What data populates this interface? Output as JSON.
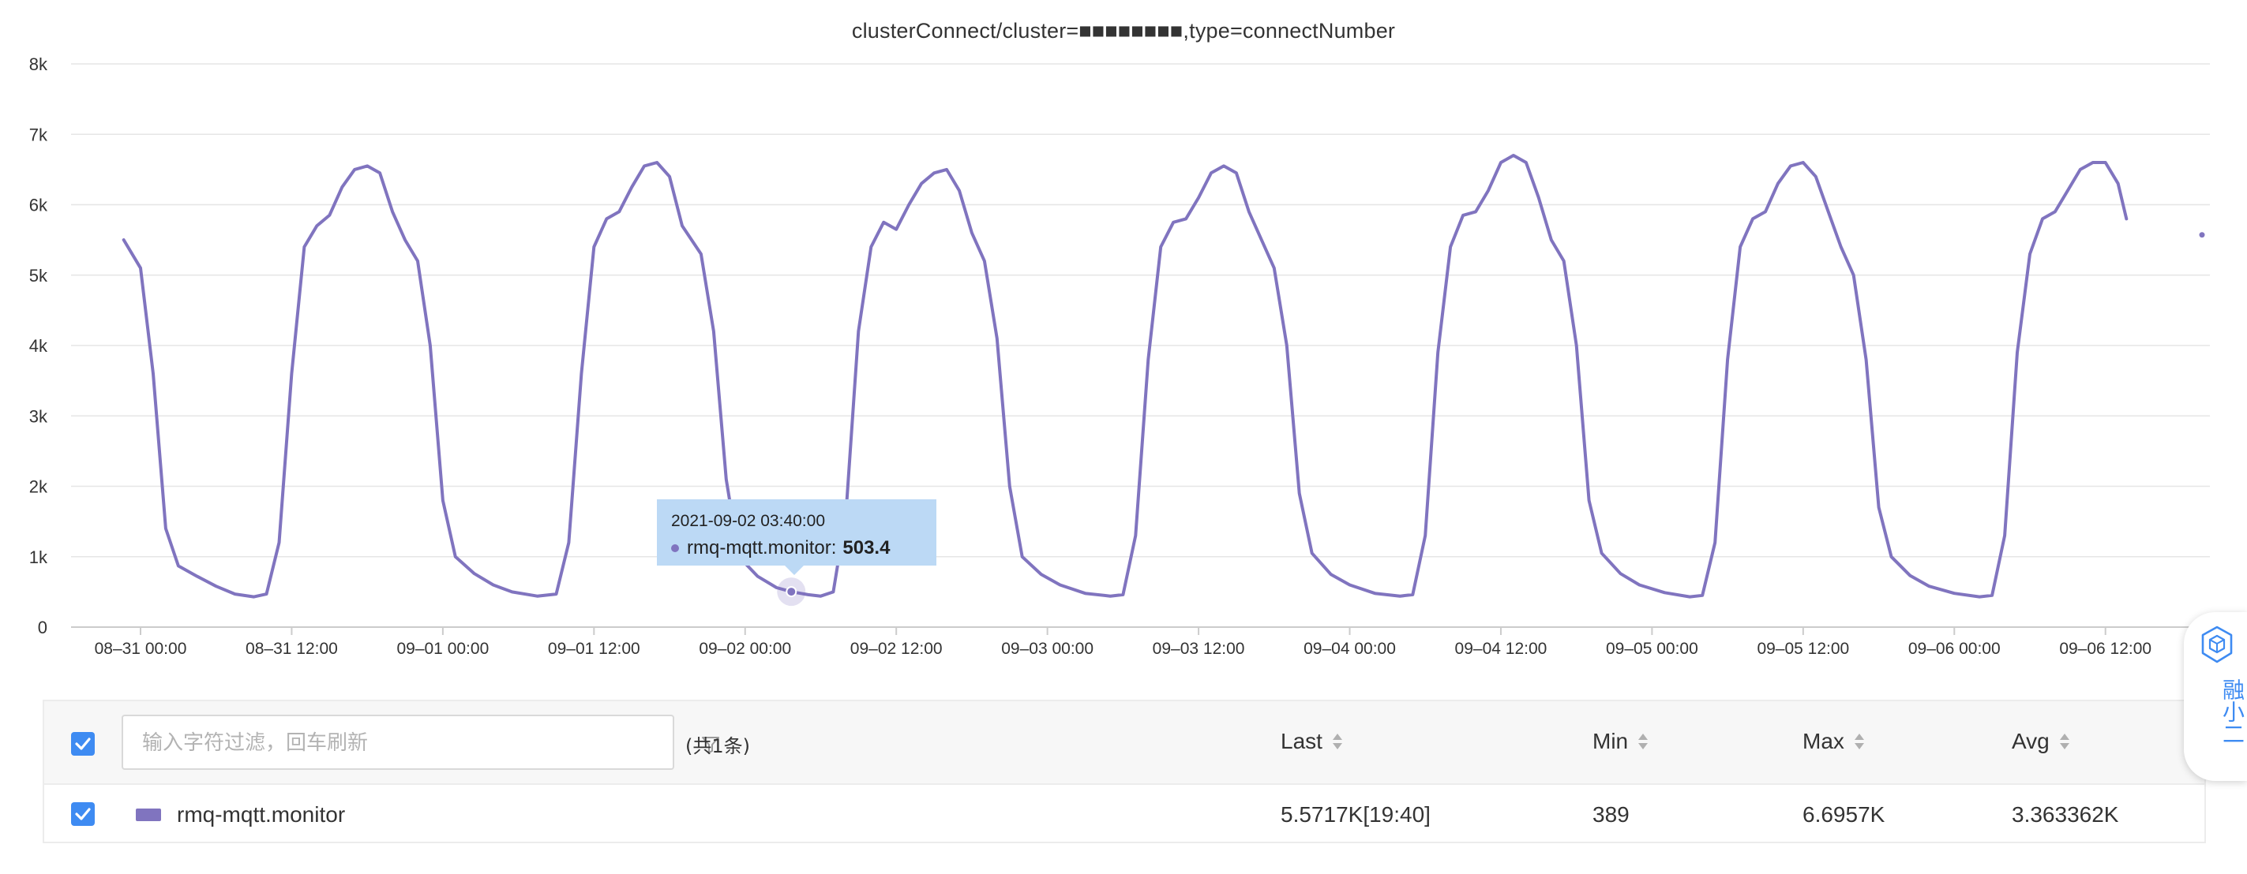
{
  "chart": {
    "title": "clusterConnect/cluster=■■■■■■■■,type=connectNumber",
    "accent_color": "#8074bf",
    "tooltip": {
      "time": "2021-09-02 03:40:00",
      "series": "rmq-mqtt.monitor",
      "value": "503.4"
    }
  },
  "chart_data": {
    "type": "line",
    "title": "clusterConnect/cluster=■■■■■■■■,type=connectNumber",
    "xlabel": "",
    "ylabel": "",
    "y_ticks": [
      "0",
      "1k",
      "2k",
      "3k",
      "4k",
      "5k",
      "6k",
      "7k",
      "8k"
    ],
    "x_ticks": [
      "08-31 00:00",
      "08-31 12:00",
      "09-01 00:00",
      "09-01 12:00",
      "09-02 00:00",
      "09-02 12:00",
      "09-03 00:00",
      "09-03 12:00",
      "09-04 00:00",
      "09-04 12:00",
      "09-05 00:00",
      "09-05 12:00",
      "09-06 00:00",
      "09-06 12:00"
    ],
    "ylim": [
      0,
      8000
    ],
    "xlim": [
      "2021-08-30 22:40",
      "2021-09-06 19:40"
    ],
    "grid": true,
    "series": [
      {
        "name": "rmq-mqtt.monitor",
        "color": "#8074bf",
        "points": [
          [
            "2021-08-30 22:40",
            5500
          ],
          [
            "2021-08-31 00:00",
            5100
          ],
          [
            "2021-08-31 01:00",
            3600
          ],
          [
            "2021-08-31 02:00",
            1400
          ],
          [
            "2021-08-31 03:00",
            870
          ],
          [
            "2021-08-31 04:30",
            720
          ],
          [
            "2021-08-31 06:00",
            580
          ],
          [
            "2021-08-31 07:30",
            470
          ],
          [
            "2021-08-31 09:00",
            430
          ],
          [
            "2021-08-31 10:00",
            470
          ],
          [
            "2021-08-31 11:00",
            1200
          ],
          [
            "2021-08-31 12:00",
            3600
          ],
          [
            "2021-08-31 13:00",
            5400
          ],
          [
            "2021-08-31 14:00",
            5700
          ],
          [
            "2021-08-31 15:00",
            5850
          ],
          [
            "2021-08-31 16:00",
            6250
          ],
          [
            "2021-08-31 17:00",
            6500
          ],
          [
            "2021-08-31 18:00",
            6550
          ],
          [
            "2021-08-31 19:00",
            6450
          ],
          [
            "2021-08-31 20:00",
            5900
          ],
          [
            "2021-08-31 21:00",
            5500
          ],
          [
            "2021-08-31 22:00",
            5200
          ],
          [
            "2021-08-31 23:00",
            4000
          ],
          [
            "2021-09-01 00:00",
            1800
          ],
          [
            "2021-09-01 01:00",
            1000
          ],
          [
            "2021-09-01 02:30",
            760
          ],
          [
            "2021-09-01 04:00",
            600
          ],
          [
            "2021-09-01 05:30",
            500
          ],
          [
            "2021-09-01 07:30",
            440
          ],
          [
            "2021-09-01 09:00",
            470
          ],
          [
            "2021-09-01 10:00",
            1200
          ],
          [
            "2021-09-01 11:00",
            3600
          ],
          [
            "2021-09-01 12:00",
            5400
          ],
          [
            "2021-09-01 13:00",
            5800
          ],
          [
            "2021-09-01 14:00",
            5900
          ],
          [
            "2021-09-01 15:00",
            6250
          ],
          [
            "2021-09-01 16:00",
            6550
          ],
          [
            "2021-09-01 17:00",
            6600
          ],
          [
            "2021-09-01 18:00",
            6400
          ],
          [
            "2021-09-01 19:00",
            5700
          ],
          [
            "2021-09-01 20:30",
            5300
          ],
          [
            "2021-09-01 21:30",
            4200
          ],
          [
            "2021-09-01 22:30",
            2100
          ],
          [
            "2021-09-01 23:30",
            1000
          ],
          [
            "2021-09-02 01:00",
            720
          ],
          [
            "2021-09-02 02:30",
            560
          ],
          [
            "2021-09-02 03:40",
            503.4
          ],
          [
            "2021-09-02 05:00",
            460
          ],
          [
            "2021-09-02 06:00",
            440
          ],
          [
            "2021-09-02 07:00",
            500
          ],
          [
            "2021-09-02 08:00",
            1600
          ],
          [
            "2021-09-02 09:00",
            4200
          ],
          [
            "2021-09-02 10:00",
            5400
          ],
          [
            "2021-09-02 11:00",
            5750
          ],
          [
            "2021-09-02 12:00",
            5650
          ],
          [
            "2021-09-02 13:00",
            6000
          ],
          [
            "2021-09-02 14:00",
            6300
          ],
          [
            "2021-09-02 15:00",
            6450
          ],
          [
            "2021-09-02 16:00",
            6500
          ],
          [
            "2021-09-02 17:00",
            6200
          ],
          [
            "2021-09-02 18:00",
            5600
          ],
          [
            "2021-09-02 19:00",
            5200
          ],
          [
            "2021-09-02 20:00",
            4100
          ],
          [
            "2021-09-02 21:00",
            2000
          ],
          [
            "2021-09-02 22:00",
            1000
          ],
          [
            "2021-09-02 23:30",
            750
          ],
          [
            "2021-09-03 01:00",
            600
          ],
          [
            "2021-09-03 03:00",
            480
          ],
          [
            "2021-09-03 05:00",
            440
          ],
          [
            "2021-09-03 06:00",
            460
          ],
          [
            "2021-09-03 07:00",
            1300
          ],
          [
            "2021-09-03 08:00",
            3800
          ],
          [
            "2021-09-03 09:00",
            5400
          ],
          [
            "2021-09-03 10:00",
            5750
          ],
          [
            "2021-09-03 11:00",
            5800
          ],
          [
            "2021-09-03 12:00",
            6100
          ],
          [
            "2021-09-03 13:00",
            6450
          ],
          [
            "2021-09-03 14:00",
            6550
          ],
          [
            "2021-09-03 15:00",
            6450
          ],
          [
            "2021-09-03 16:00",
            5900
          ],
          [
            "2021-09-03 17:00",
            5500
          ],
          [
            "2021-09-03 18:00",
            5100
          ],
          [
            "2021-09-03 19:00",
            4000
          ],
          [
            "2021-09-03 20:00",
            1900
          ],
          [
            "2021-09-03 21:00",
            1050
          ],
          [
            "2021-09-03 22:30",
            750
          ],
          [
            "2021-09-04 00:00",
            600
          ],
          [
            "2021-09-04 02:00",
            480
          ],
          [
            "2021-09-04 04:00",
            440
          ],
          [
            "2021-09-04 05:00",
            460
          ],
          [
            "2021-09-04 06:00",
            1300
          ],
          [
            "2021-09-04 07:00",
            3900
          ],
          [
            "2021-09-04 08:00",
            5400
          ],
          [
            "2021-09-04 09:00",
            5850
          ],
          [
            "2021-09-04 10:00",
            5900
          ],
          [
            "2021-09-04 11:00",
            6200
          ],
          [
            "2021-09-04 12:00",
            6600
          ],
          [
            "2021-09-04 13:00",
            6700
          ],
          [
            "2021-09-04 14:00",
            6600
          ],
          [
            "2021-09-04 15:00",
            6100
          ],
          [
            "2021-09-04 16:00",
            5500
          ],
          [
            "2021-09-04 17:00",
            5200
          ],
          [
            "2021-09-04 18:00",
            4000
          ],
          [
            "2021-09-04 19:00",
            1800
          ],
          [
            "2021-09-04 20:00",
            1050
          ],
          [
            "2021-09-04 21:30",
            760
          ],
          [
            "2021-09-04 23:00",
            600
          ],
          [
            "2021-09-05 01:00",
            490
          ],
          [
            "2021-09-05 03:00",
            430
          ],
          [
            "2021-09-05 04:00",
            450
          ],
          [
            "2021-09-05 05:00",
            1200
          ],
          [
            "2021-09-05 06:00",
            3800
          ],
          [
            "2021-09-05 07:00",
            5400
          ],
          [
            "2021-09-05 08:00",
            5800
          ],
          [
            "2021-09-05 09:00",
            5900
          ],
          [
            "2021-09-05 10:00",
            6300
          ],
          [
            "2021-09-05 11:00",
            6550
          ],
          [
            "2021-09-05 12:00",
            6600
          ],
          [
            "2021-09-05 13:00",
            6400
          ],
          [
            "2021-09-05 14:00",
            5900
          ],
          [
            "2021-09-05 15:00",
            5400
          ],
          [
            "2021-09-05 16:00",
            5000
          ],
          [
            "2021-09-05 17:00",
            3800
          ],
          [
            "2021-09-05 18:00",
            1700
          ],
          [
            "2021-09-05 19:00",
            1000
          ],
          [
            "2021-09-05 20:30",
            730
          ],
          [
            "2021-09-05 22:00",
            580
          ],
          [
            "2021-09-06 00:00",
            480
          ],
          [
            "2021-09-06 02:00",
            430
          ],
          [
            "2021-09-06 03:00",
            450
          ],
          [
            "2021-09-06 04:00",
            1300
          ],
          [
            "2021-09-06 05:00",
            3900
          ],
          [
            "2021-09-06 06:00",
            5300
          ],
          [
            "2021-09-06 07:00",
            5800
          ],
          [
            "2021-09-06 08:00",
            5900
          ],
          [
            "2021-09-06 09:00",
            6200
          ],
          [
            "2021-09-06 10:00",
            6500
          ],
          [
            "2021-09-06 11:00",
            6600
          ],
          [
            "2021-09-06 12:00",
            6600
          ],
          [
            "2021-09-06 13:00",
            6300
          ],
          [
            "2021-09-06 13:40",
            5800
          ],
          [
            "2021-09-06 19:40",
            5571.7
          ]
        ]
      }
    ]
  },
  "legend": {
    "filter_placeholder": "输入字符过滤，回车刷新",
    "count_text": "(共1条)",
    "columns": {
      "last": "Last",
      "min": "Min",
      "max": "Max",
      "avg": "Avg"
    },
    "rows": [
      {
        "name": "rmq-mqtt.monitor",
        "color": "#8074bf",
        "last": "5.5717K[19:40]",
        "min": "389",
        "max": "6.6957K",
        "avg": "3.363362K",
        "checked": true
      }
    ],
    "select_all_checked": true
  },
  "assistant": {
    "label": "融小二",
    "icon": "cube-icon",
    "color": "#3e8bf2"
  }
}
